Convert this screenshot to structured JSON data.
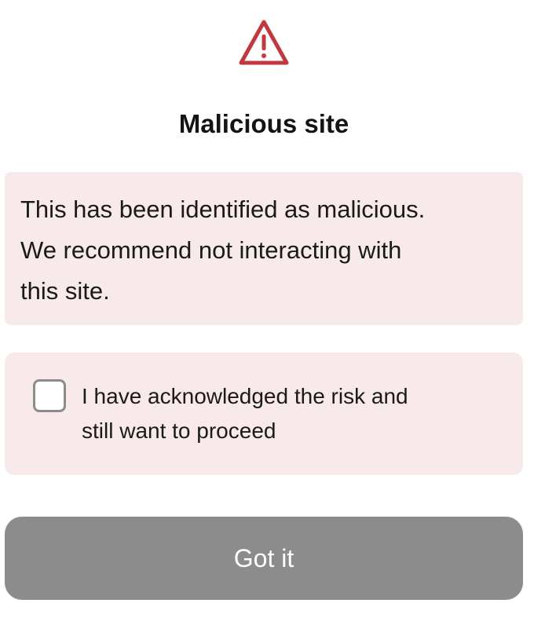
{
  "dialog": {
    "icon": "warning-triangle-icon",
    "icon_color": "#c0393f",
    "title": "Malicious site",
    "alert": {
      "text": "This has been identified as malicious.\nWe recommend not interacting with\nthis site.",
      "background": "#f8eaea"
    },
    "acknowledgement": {
      "checked": false,
      "label": "I have acknowledged the risk and\nstill want to proceed"
    },
    "button": {
      "label": "Got it",
      "background": "#8c8c8c",
      "enabled": false
    }
  }
}
